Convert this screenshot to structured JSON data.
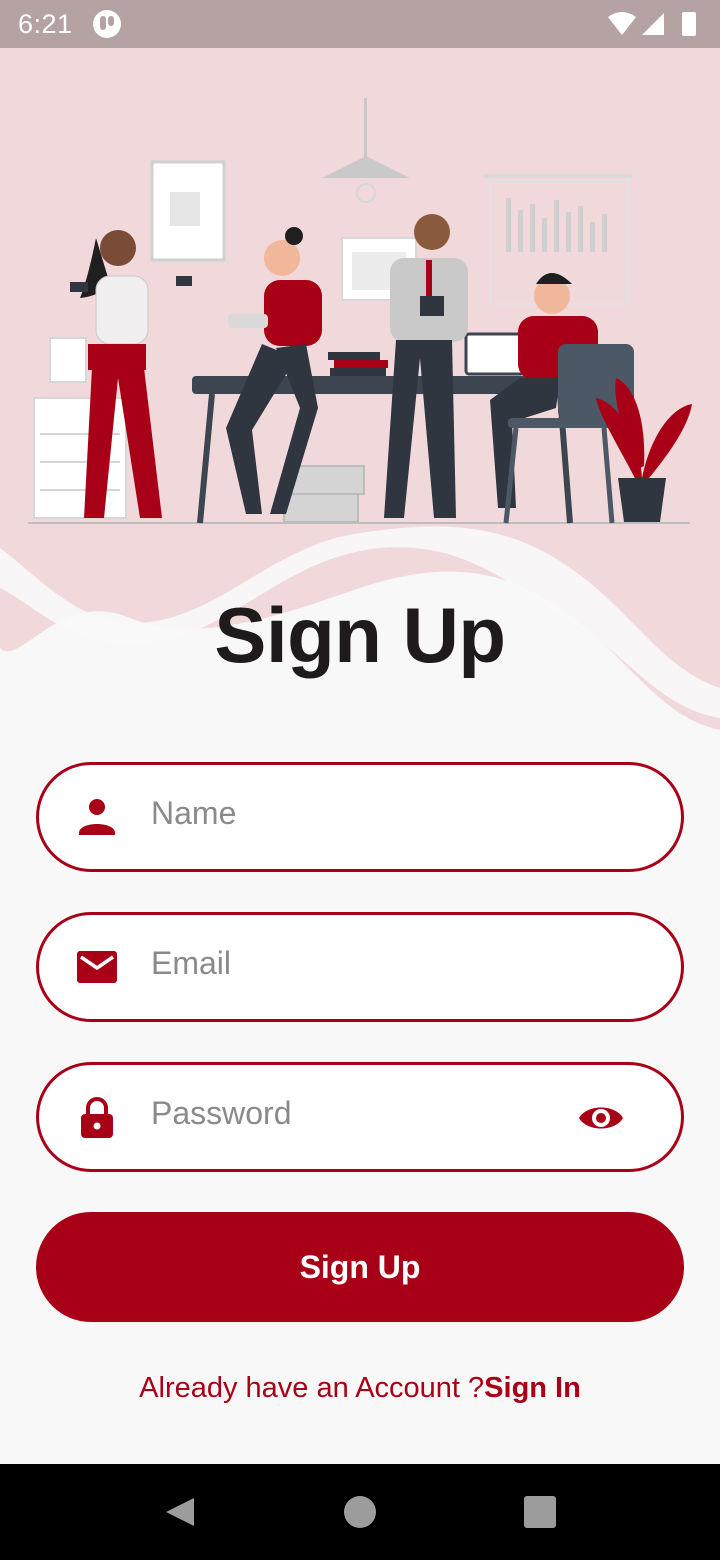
{
  "status_bar": {
    "time": "6:21"
  },
  "title": "Sign Up",
  "form": {
    "name_placeholder": "Name",
    "email_placeholder": "Email",
    "password_placeholder": "Password"
  },
  "signup_button": "Sign Up",
  "footer": {
    "prompt": "Already have an Account ?",
    "link": "Sign In"
  },
  "icons": {
    "name": "person-icon",
    "email": "mail-icon",
    "password": "lock-icon",
    "toggle": "eye-icon"
  },
  "colors": {
    "accent": "#a80016",
    "hero_bg": "#f1d9db",
    "background": "#f8f8f8"
  }
}
